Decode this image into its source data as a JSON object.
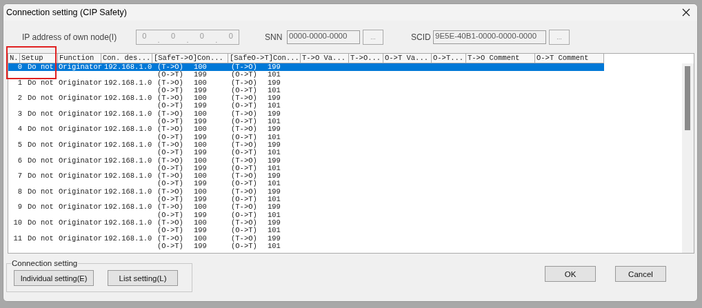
{
  "window": {
    "title": "Connection setting (CIP Safety)"
  },
  "ip_address": {
    "label": "IP address of own node(I)",
    "octets": [
      "0",
      "0",
      "0",
      "0"
    ],
    "separator": "."
  },
  "snn": {
    "label": "SNN",
    "value": "0000-0000-0000",
    "button": "..."
  },
  "scid": {
    "label": "SCID",
    "value": "9E5E-40B1-0000-0000-0000",
    "button": "..."
  },
  "table": {
    "columns": [
      "N..",
      "Setup",
      "Function",
      "Con. des...",
      "[SafeT->O]Con...",
      "[SafeO->T]Con...",
      "T->O Va...",
      "T->O...",
      "O->T Va...",
      "O->T...",
      "T->O Comment",
      "O->T Comment"
    ],
    "rows": [
      {
        "no": "0",
        "setup": "Do not",
        "function": "Originator",
        "con_dest": "192.168.1.0",
        "safe_to": [
          [
            "(T->O)",
            "100"
          ],
          [
            "(O->T)",
            "199"
          ]
        ],
        "safe_ot": [
          [
            "(T->O)",
            "199"
          ],
          [
            "(O->T)",
            "101"
          ]
        ],
        "selected": true
      },
      {
        "no": "1",
        "setup": "Do not",
        "function": "Originator",
        "con_dest": "192.168.1.0",
        "safe_to": [
          [
            "(T->O)",
            "100"
          ],
          [
            "(O->T)",
            "199"
          ]
        ],
        "safe_ot": [
          [
            "(T->O)",
            "199"
          ],
          [
            "(O->T)",
            "101"
          ]
        ],
        "selected": false
      },
      {
        "no": "2",
        "setup": "Do not",
        "function": "Originator",
        "con_dest": "192.168.1.0",
        "safe_to": [
          [
            "(T->O)",
            "100"
          ],
          [
            "(O->T)",
            "199"
          ]
        ],
        "safe_ot": [
          [
            "(T->O)",
            "199"
          ],
          [
            "(O->T)",
            "101"
          ]
        ],
        "selected": false
      },
      {
        "no": "3",
        "setup": "Do not",
        "function": "Originator",
        "con_dest": "192.168.1.0",
        "safe_to": [
          [
            "(T->O)",
            "100"
          ],
          [
            "(O->T)",
            "199"
          ]
        ],
        "safe_ot": [
          [
            "(T->O)",
            "199"
          ],
          [
            "(O->T)",
            "101"
          ]
        ],
        "selected": false
      },
      {
        "no": "4",
        "setup": "Do not",
        "function": "Originator",
        "con_dest": "192.168.1.0",
        "safe_to": [
          [
            "(T->O)",
            "100"
          ],
          [
            "(O->T)",
            "199"
          ]
        ],
        "safe_ot": [
          [
            "(T->O)",
            "199"
          ],
          [
            "(O->T)",
            "101"
          ]
        ],
        "selected": false
      },
      {
        "no": "5",
        "setup": "Do not",
        "function": "Originator",
        "con_dest": "192.168.1.0",
        "safe_to": [
          [
            "(T->O)",
            "100"
          ],
          [
            "(O->T)",
            "199"
          ]
        ],
        "safe_ot": [
          [
            "(T->O)",
            "199"
          ],
          [
            "(O->T)",
            "101"
          ]
        ],
        "selected": false
      },
      {
        "no": "6",
        "setup": "Do not",
        "function": "Originator",
        "con_dest": "192.168.1.0",
        "safe_to": [
          [
            "(T->O)",
            "100"
          ],
          [
            "(O->T)",
            "199"
          ]
        ],
        "safe_ot": [
          [
            "(T->O)",
            "199"
          ],
          [
            "(O->T)",
            "101"
          ]
        ],
        "selected": false
      },
      {
        "no": "7",
        "setup": "Do not",
        "function": "Originator",
        "con_dest": "192.168.1.0",
        "safe_to": [
          [
            "(T->O)",
            "100"
          ],
          [
            "(O->T)",
            "199"
          ]
        ],
        "safe_ot": [
          [
            "(T->O)",
            "199"
          ],
          [
            "(O->T)",
            "101"
          ]
        ],
        "selected": false
      },
      {
        "no": "8",
        "setup": "Do not",
        "function": "Originator",
        "con_dest": "192.168.1.0",
        "safe_to": [
          [
            "(T->O)",
            "100"
          ],
          [
            "(O->T)",
            "199"
          ]
        ],
        "safe_ot": [
          [
            "(T->O)",
            "199"
          ],
          [
            "(O->T)",
            "101"
          ]
        ],
        "selected": false
      },
      {
        "no": "9",
        "setup": "Do not",
        "function": "Originator",
        "con_dest": "192.168.1.0",
        "safe_to": [
          [
            "(T->O)",
            "100"
          ],
          [
            "(O->T)",
            "199"
          ]
        ],
        "safe_ot": [
          [
            "(T->O)",
            "199"
          ],
          [
            "(O->T)",
            "101"
          ]
        ],
        "selected": false
      },
      {
        "no": "10",
        "setup": "Do not",
        "function": "Originator",
        "con_dest": "192.168.1.0",
        "safe_to": [
          [
            "(T->O)",
            "100"
          ],
          [
            "(O->T)",
            "199"
          ]
        ],
        "safe_ot": [
          [
            "(T->O)",
            "199"
          ],
          [
            "(O->T)",
            "101"
          ]
        ],
        "selected": false
      },
      {
        "no": "11",
        "setup": "Do not",
        "function": "Originator",
        "con_dest": "192.168.1.0",
        "safe_to": [
          [
            "(T->O)",
            "100"
          ],
          [
            "(O->T)",
            "199"
          ]
        ],
        "safe_ot": [
          [
            "(T->O)",
            "199"
          ],
          [
            "(O->T)",
            "101"
          ]
        ],
        "selected": false
      }
    ]
  },
  "connection_setting": {
    "title": "Connection setting",
    "buttons": [
      "Individual setting(E)",
      "List setting(L)"
    ]
  },
  "buttons": [
    "OK",
    "Cancel"
  ]
}
